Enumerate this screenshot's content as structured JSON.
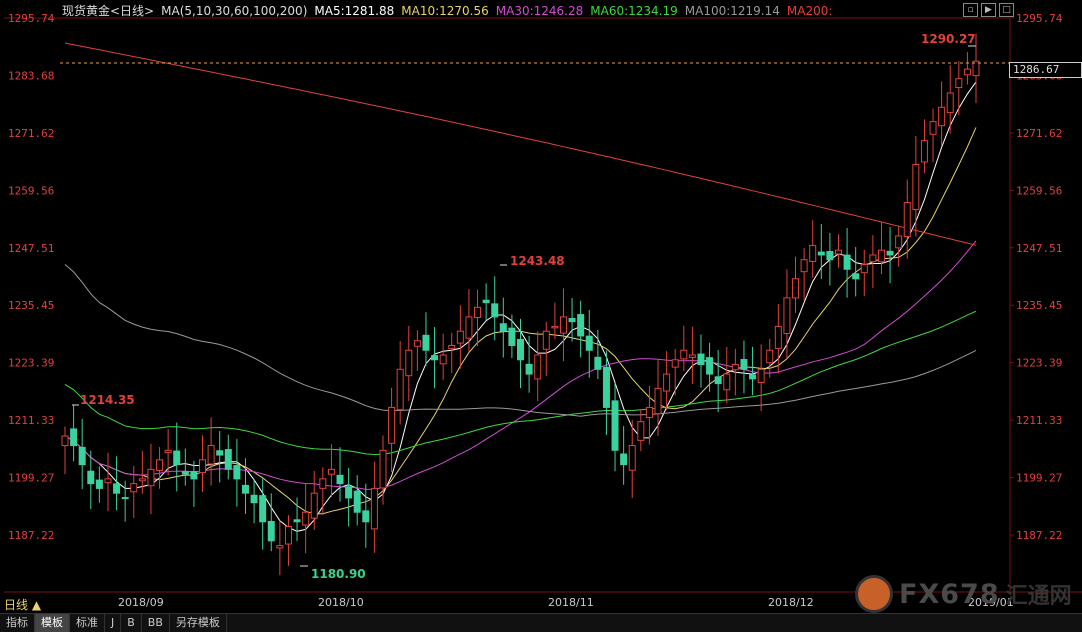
{
  "header": {
    "title": "现货黄金<日线>",
    "ma_params": "MA(5,10,30,60,100,200)",
    "ma5": "MA5:1281.88",
    "ma10": "MA10:1270.56",
    "ma30": "MA30:1246.28",
    "ma60": "MA60:1234.19",
    "ma100": "MA100:1219.14",
    "ma200": "MA200:"
  },
  "colors": {
    "title": "#dddddd",
    "ma5": "#ffffff",
    "ma10": "#e8d36a",
    "ma30": "#d24bd2",
    "ma60": "#3fd93f",
    "ma100": "#999999",
    "ma200": "#e0413c",
    "up": "#e0413c",
    "down": "#3bd1a0"
  },
  "y_axis": [
    "1295.74",
    "1283.68",
    "1271.62",
    "1259.56",
    "1247.51",
    "1235.45",
    "1223.39",
    "1211.33",
    "1199.27",
    "1187.22"
  ],
  "current_price": "1286.67",
  "x_axis": [
    "2018/09",
    "2018/10",
    "2018/11",
    "2018/12",
    "2019/01"
  ],
  "annotations": {
    "high_sep": "1214.35",
    "low_oct": "1180.90",
    "high_nov": "1243.48",
    "high_jan": "1290.27"
  },
  "period_label": "日线",
  "period_arrow": "▲",
  "bottom_tabs": [
    "指标",
    "模板",
    "标准",
    "J",
    "B",
    "BB",
    "另存模板"
  ],
  "win_icons": [
    "restore-icon",
    "play-icon",
    "maximize-icon"
  ],
  "watermark": {
    "brand": "FX678",
    "cn": "汇通网"
  }
}
